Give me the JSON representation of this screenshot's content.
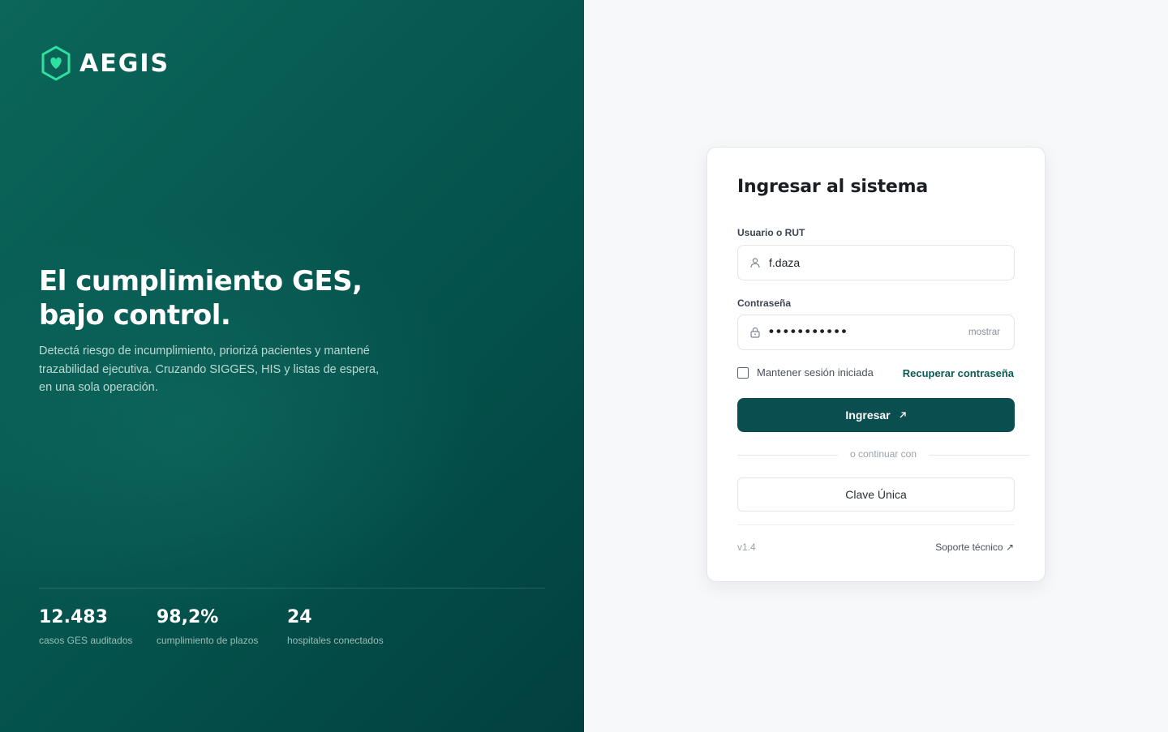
{
  "brand": {
    "name": "AEGIS",
    "accent_color": "#2fe0a0",
    "icon": "hexagon-heart-icon"
  },
  "hero": {
    "title": "El cumplimiento GES, bajo control.",
    "subtitle": "Detectá riesgo de incumplimiento, priorizá pacientes y mantené trazabilidad ejecutiva. Cruzando SIGGES, HIS y listas de espera, en una sola operación."
  },
  "stats": [
    {
      "value": "12.483",
      "label": "casos GES auditados"
    },
    {
      "value": "98,2%",
      "label": "cumplimiento de plazos"
    },
    {
      "value": "24",
      "label": "hospitales conectados"
    }
  ],
  "login": {
    "title": "Ingresar al sistema",
    "username_label": "Usuario o RUT",
    "username_value": "f.daza",
    "username_icon": "user-icon",
    "password_label": "Contraseña",
    "password_masked": "•••••••••••",
    "password_icon": "lock-icon",
    "show_password_label": "mostrar",
    "remember_label": "Mantener sesión iniciada",
    "remember_checked": false,
    "recover_label": "Recuperar contraseña",
    "submit_label": "Ingresar",
    "submit_icon": "arrow-up-right-icon",
    "divider_text": "o continuar con",
    "alt_login_label": "Clave Única",
    "version": "v1.4",
    "support_label": "Soporte técnico ↗"
  },
  "colors": {
    "panel_dark": "#04514b",
    "primary_button": "#0b4e4f",
    "link": "#0c5a54"
  }
}
